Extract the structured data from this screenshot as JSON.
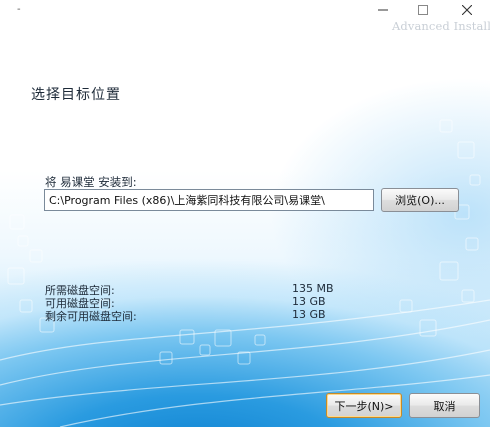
{
  "window": {
    "title": "-",
    "brand": "Advanced Installer"
  },
  "page": {
    "title": "选择目标位置"
  },
  "install_path": {
    "label": "将 易课堂 安装到:",
    "value": "C:\\Program Files (x86)\\上海紫同科技有限公司\\易课堂\\",
    "browse_label": "浏览(O)..."
  },
  "disk_space": {
    "rows": [
      {
        "label": "所需磁盘空间:",
        "value": "135 MB"
      },
      {
        "label": "可用磁盘空间:",
        "value": "13 GB"
      },
      {
        "label": "剩余可用磁盘空间:",
        "value": "13 GB"
      }
    ]
  },
  "buttons": {
    "next_label": "下一步(N)>",
    "cancel_label": "取消"
  },
  "icons": {
    "minimize": "minimize-icon",
    "maximize": "maximize-icon",
    "close": "close-icon"
  },
  "colors": {
    "accent": "#2a9be0",
    "default_button_border": "#c58a2a"
  }
}
